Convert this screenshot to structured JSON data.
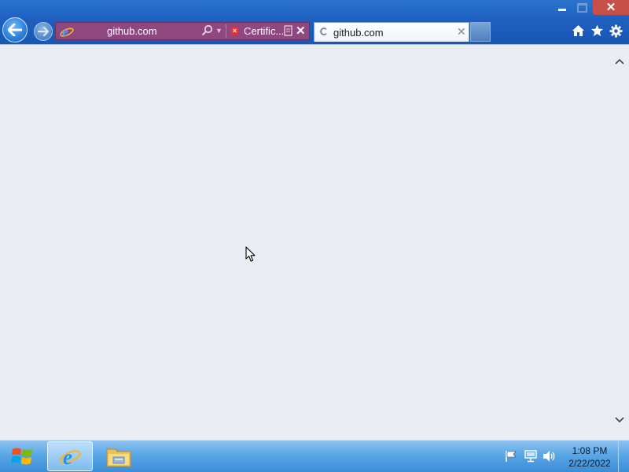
{
  "window": {
    "minimize_icon": "minimize-icon",
    "maximize_icon": "maximize-icon",
    "close_icon": "close-icon",
    "close_glyph": "✕"
  },
  "address_bar": {
    "url_text": "github.com",
    "certificate_status": "Certific...",
    "certificate_icon": "certificate-error-icon",
    "search_icon": "search-icon",
    "dropdown_icon": "chevron-down-icon",
    "compat_icon": "compatibility-view-icon",
    "close_glyph": "✕",
    "color": "#8f4780"
  },
  "tab": {
    "title": "github.com",
    "close_glyph": "✕"
  },
  "command_bar": {
    "home_icon": "home-icon",
    "favorites_icon": "star-icon",
    "tools_icon": "gear-icon"
  },
  "taskbar": {
    "start_icon": "windows-logo-icon",
    "pinned": [
      "internet-explorer-icon",
      "file-explorer-icon"
    ],
    "clock": {
      "time": "1:08 PM",
      "date": "2/22/2022"
    }
  }
}
